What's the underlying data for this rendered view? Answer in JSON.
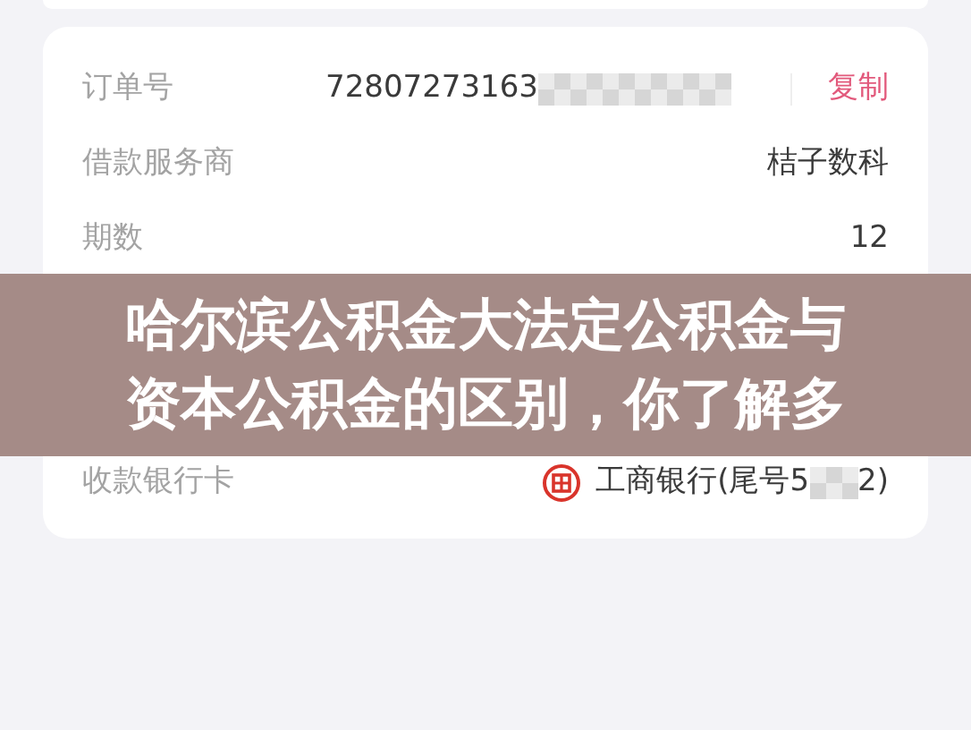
{
  "rows": [
    {
      "kind": "order",
      "label": "订单号",
      "value": "72807273163",
      "redacted": true,
      "action": "复制"
    },
    {
      "kind": "text",
      "label": "借款服务商",
      "value": "桔子数科"
    },
    {
      "kind": "text",
      "label": "期数",
      "value": "12"
    },
    {
      "kind": "bank",
      "label": "收款银行卡",
      "value": "工商银行(尾号5",
      "value_tail": "2)",
      "redacted": true
    }
  ],
  "banner": {
    "title_lines": [
      "哈尔滨公积金大法定公积金与",
      "资本公积金的区别，你了解多"
    ]
  }
}
